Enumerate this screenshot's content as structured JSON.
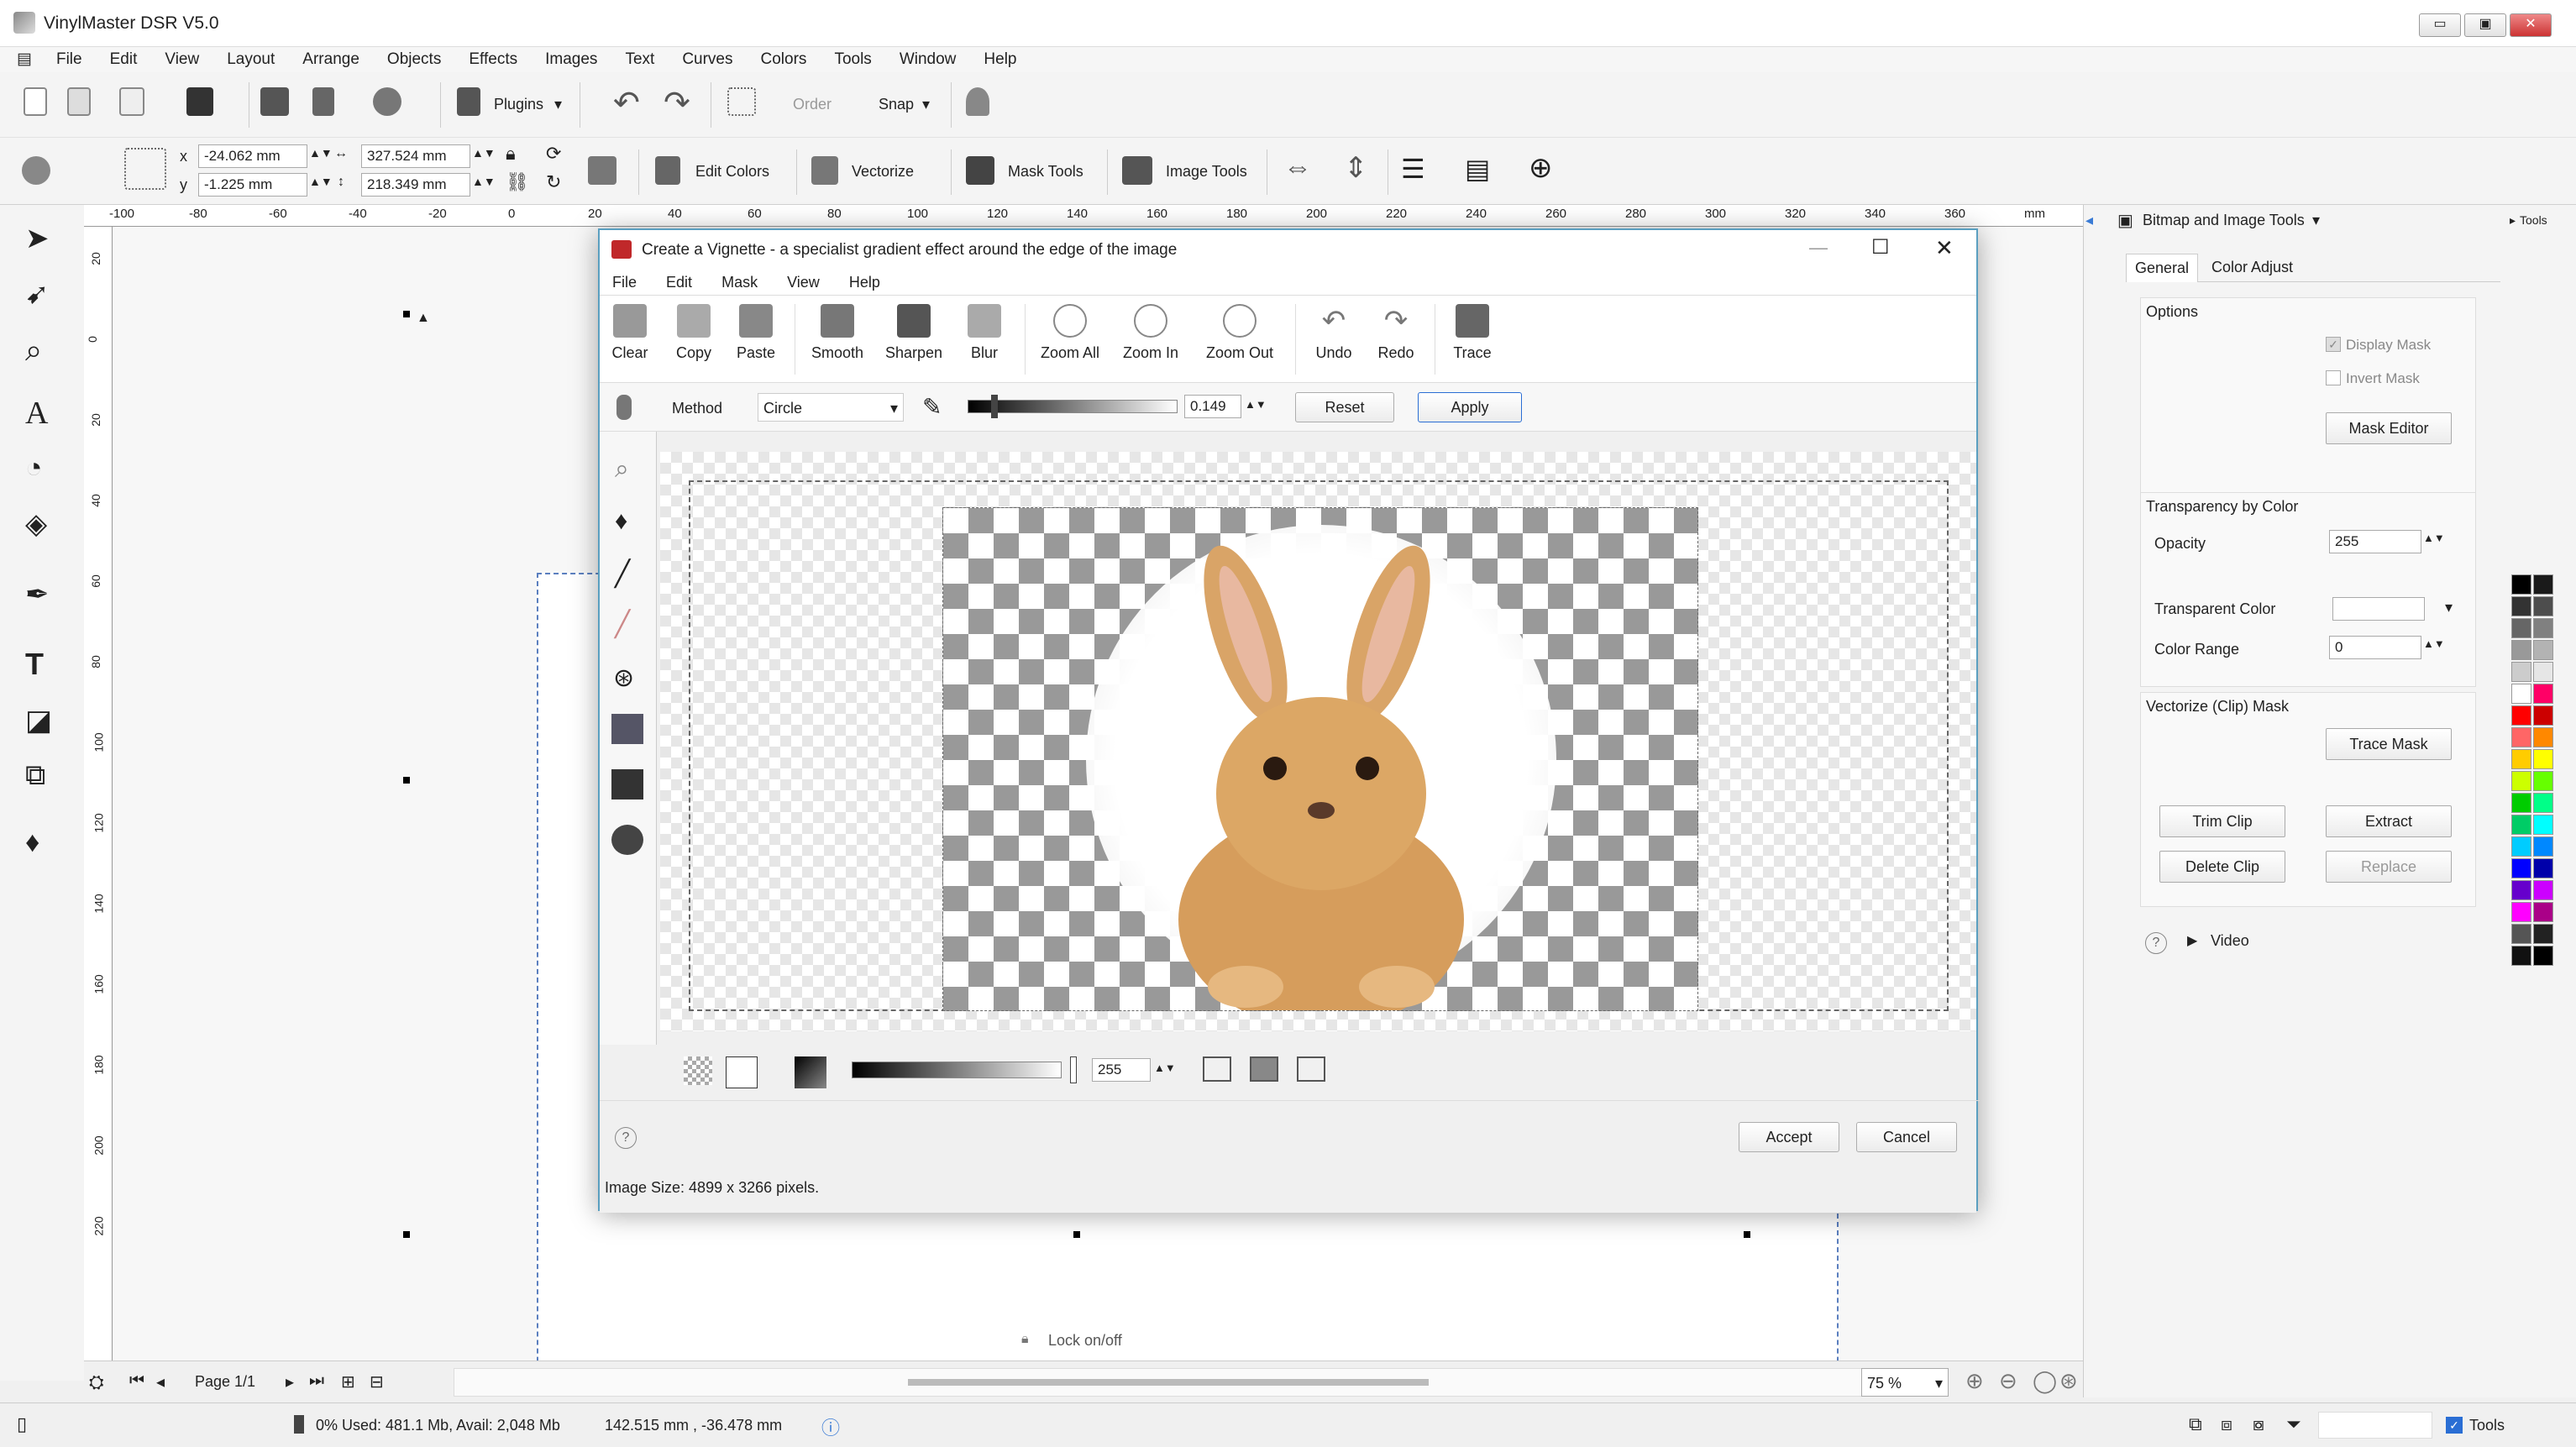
{
  "app": {
    "title": "VinylMaster DSR V5.0",
    "win_min": "▭",
    "win_max": "▣",
    "win_close": "✕"
  },
  "menu": [
    "File",
    "Edit",
    "View",
    "Layout",
    "Arrange",
    "Objects",
    "Effects",
    "Images",
    "Text",
    "Curves",
    "Colors",
    "Tools",
    "Window",
    "Help"
  ],
  "toolbar": {
    "plugins": "Plugins",
    "order": "Order",
    "snap": "Snap",
    "edit_colors": "Edit Colors",
    "vectorize": "Vectorize",
    "mask_tools": "Mask Tools",
    "image_tools": "Image Tools",
    "x_label": "x",
    "y_label": "y",
    "x": "-24.062 mm",
    "y": "-1.225 mm",
    "w": "327.524 mm",
    "h": "218.349 mm"
  },
  "ruler_top": [
    "-100",
    "-80",
    "-60",
    "-40",
    "-20",
    "0",
    "20",
    "40",
    "60",
    "80",
    "100",
    "120",
    "140",
    "160",
    "180",
    "200",
    "220",
    "240",
    "260",
    "280",
    "300",
    "320",
    "340",
    "360",
    "mm"
  ],
  "ruler_left": [
    "20",
    "0",
    "20",
    "40",
    "60",
    "80",
    "100",
    "120",
    "140",
    "160",
    "180",
    "200",
    "220"
  ],
  "dialog": {
    "title": "Create a Vignette - a specialist gradient effect around the edge of the image",
    "menu": [
      "File",
      "Edit",
      "Mask",
      "View",
      "Help"
    ],
    "tools": [
      "Clear",
      "Copy",
      "Paste",
      "Smooth",
      "Sharpen",
      "Blur",
      "Zoom All",
      "Zoom In",
      "Zoom Out",
      "Undo",
      "Redo",
      "Trace"
    ],
    "method_label": "Method",
    "method_value": "Circle",
    "slider_value": "0.149",
    "reset": "Reset",
    "apply": "Apply",
    "opacity_value": "255",
    "accept": "Accept",
    "cancel": "Cancel",
    "help": "?",
    "image_size": "Image Size: 4899 x 3266 pixels."
  },
  "panel": {
    "header": "Bitmap and Image Tools",
    "tab_general": "General",
    "tab_color_adjust": "Color Adjust",
    "options": "Options",
    "display_mask": "Display Mask",
    "invert_mask": "Invert Mask",
    "mask_editor": "Mask Editor",
    "transparency_by_color": "Transparency by Color",
    "opacity": "Opacity",
    "opacity_value": "255",
    "transparent_color": "Transparent Color",
    "color_range": "Color Range",
    "color_range_value": "0",
    "vectorize_clip_mask": "Vectorize (Clip) Mask",
    "trace_mask": "Trace Mask",
    "trim_clip": "Trim Clip",
    "extract": "Extract",
    "delete_clip": "Delete Clip",
    "replace": "Replace",
    "video": "Video",
    "help": "?",
    "tools_tab": "Tools"
  },
  "bottom": {
    "page": "Page 1/1",
    "lock": "Lock on/off",
    "zoom": "75 %"
  },
  "status": {
    "memory": "0%  Used: 481.1 Mb, Avail: 2,048 Mb",
    "coords": "142.515 mm , -36.478 mm",
    "tools": "Tools"
  },
  "palette": [
    "#000000",
    "#1a1a1a",
    "#333333",
    "#4d4d4d",
    "#666666",
    "#808080",
    "#999999",
    "#b3b3b3",
    "#cccccc",
    "#e6e6e6",
    "#ffffff",
    "#ff0066",
    "#ff0000",
    "#cc0000",
    "#ff6666",
    "#ff8800",
    "#ffcc00",
    "#ffff00",
    "#ccff00",
    "#66ff00",
    "#00cc00",
    "#00ff88",
    "#00cc66",
    "#00ffff",
    "#00ccff",
    "#0088ff",
    "#0000ff",
    "#0000aa",
    "#6600cc",
    "#cc00ff",
    "#ff00ff",
    "#aa0088",
    "#555555",
    "#222222",
    "#111111",
    "#000000"
  ]
}
